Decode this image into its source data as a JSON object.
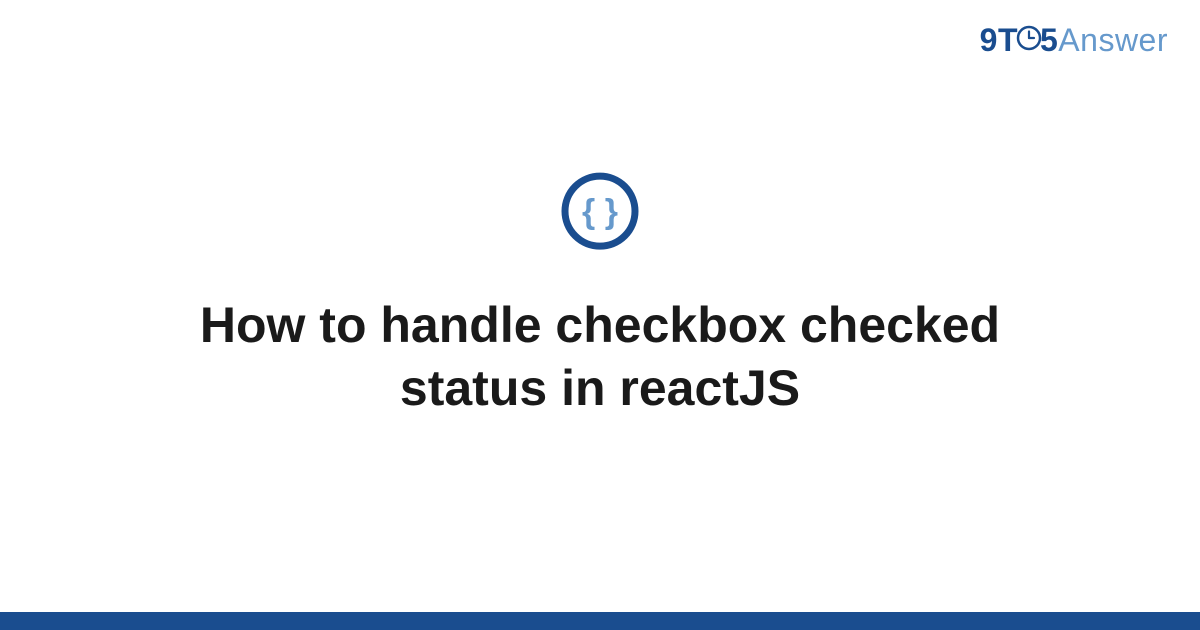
{
  "logo": {
    "nine": "9",
    "t": "T",
    "five": "5",
    "answer": "Answer"
  },
  "icon": {
    "braces": "{ }"
  },
  "title": "How to handle checkbox checked status in reactJS",
  "colors": {
    "brand_dark": "#1a4d8f",
    "brand_light": "#6699cc"
  }
}
